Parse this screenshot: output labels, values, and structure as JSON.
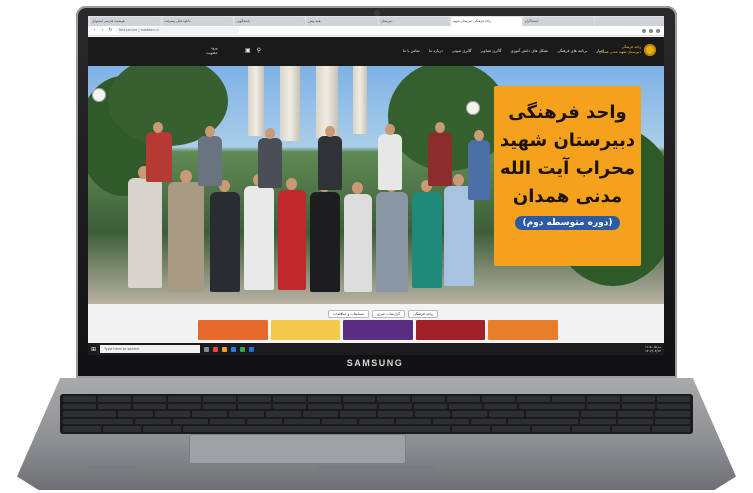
{
  "device": {
    "brand": "SAMSUNG"
  },
  "browser": {
    "tabs": [
      {
        "label": "هوشمند فارسی لیستهای"
      },
      {
        "label": "دانلود فایل پیشرفت"
      },
      {
        "label": "پاسخگویی"
      },
      {
        "label": "همه پیش"
      },
      {
        "label": "دبیرستان"
      },
      {
        "label": "واحد فرهنگی دبیرستان شهید",
        "active": true
      },
      {
        "label": "اینستاگرام"
      },
      {
        "label": ""
      }
    ],
    "url": "Not secure | maddani.ir"
  },
  "site": {
    "logo_text": [
      "واحد فرهنگی",
      "دبیرستان شهید مدنی همدان"
    ],
    "menu": [
      "اخبار",
      "برنامه های فرهنگی",
      "تشکل های دانش آموزی",
      "گالری تصاویر",
      "گالری صوتی",
      "درباره ما",
      "تماس با ما"
    ],
    "login": [
      "ورود",
      "عضویت"
    ],
    "icons": {
      "search": "search-icon",
      "cart": "cart-icon"
    }
  },
  "hero": {
    "banner_lines": [
      "واحد فرهنگی",
      "دبیرستان شهید",
      "محراب آیت الله",
      "مدنی همدان"
    ],
    "banner_sub": "(دوره متوسطه دوم)"
  },
  "filters": [
    "واحد فرهنگی",
    "گزارشات خبری",
    "مسابقات و مناقصات"
  ],
  "taskbar": {
    "search_placeholder": "Type here to search",
    "time": "۱۱:۵۰ ب.ظ",
    "date": "۱۴۰۲/۰۲/۱۴"
  },
  "colors": {
    "banner": "#f4a11d",
    "header": "#1a1a1a",
    "accent": "#e8b10f"
  }
}
